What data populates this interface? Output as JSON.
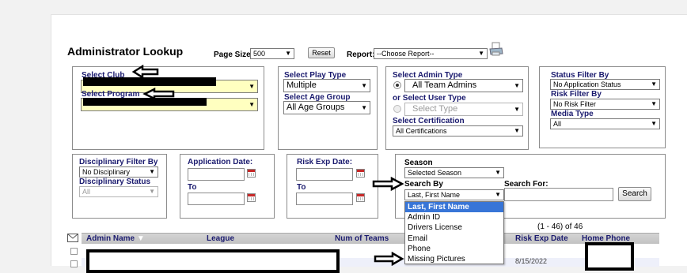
{
  "header": {
    "title": "Administrator Lookup",
    "page_size_label": "Page Size:",
    "page_size_value": "500",
    "reset_label": "Reset",
    "report_label": "Report:",
    "report_value": "--Choose Report--"
  },
  "club_box": {
    "club_label": "Select Club",
    "program_label": "Select Program"
  },
  "play_box": {
    "play_type_label": "Select Play Type",
    "play_type_value": "Multiple",
    "age_group_label": "Select Age Group",
    "age_group_value": "All Age Groups"
  },
  "admin_box": {
    "admin_type_label": "Select Admin Type",
    "admin_type_value": "All Team Admins",
    "user_type_label": "or Select User Type",
    "user_type_value": "Select Type",
    "certification_label": "Select Certification",
    "certification_value": "All Certifications"
  },
  "status_box": {
    "status_label": "Status Filter By",
    "status_value": "No Application Status",
    "risk_label": "Risk Filter By",
    "risk_value": "No Risk Filter",
    "media_label": "Media Type",
    "media_value": "All"
  },
  "disciplinary_box": {
    "filter_label": "Disciplinary Filter By",
    "filter_value": "No Disciplinary",
    "status_label": "Disciplinary Status",
    "status_value": "All"
  },
  "application_box": {
    "label": "Application Date:",
    "to_label": "To"
  },
  "risk_exp_box": {
    "label": "Risk Exp Date:",
    "to_label": "To"
  },
  "season_box": {
    "season_label": "Season",
    "season_value": "Selected Season",
    "search_by_label": "Search By",
    "search_by_value": "Last, First Name",
    "search_for_label": "Search For:",
    "search_button": "Search"
  },
  "search_by_options": [
    "Last, First Name",
    "Admin ID",
    "Drivers License",
    "Email",
    "Phone",
    "Missing Pictures"
  ],
  "results": {
    "count": "(1 - 46) of 46",
    "columns": [
      "Admin Name",
      "League",
      "Num of Teams",
      "Risk Exp Date",
      "Home Phone"
    ],
    "row_date": "8/15/2022"
  }
}
